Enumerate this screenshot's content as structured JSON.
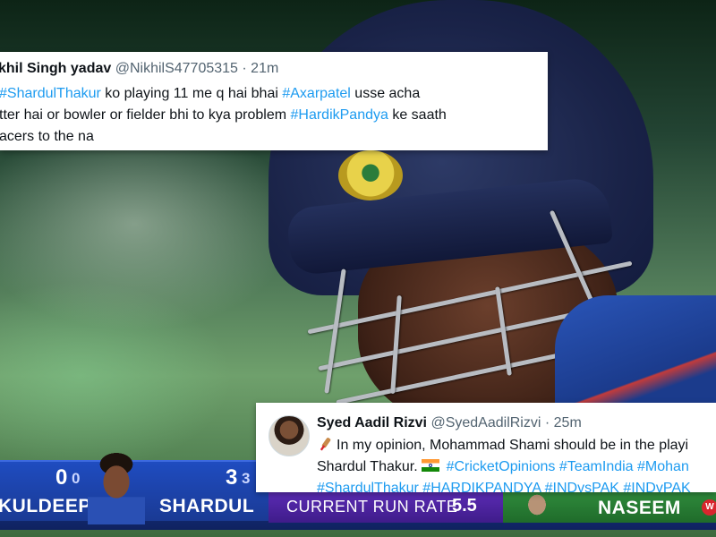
{
  "tweets": [
    {
      "author_name": "khil Singh yadav",
      "handle": "@NikhilS47705315",
      "separator": "·",
      "time": "21m",
      "line1": {
        "hashtag1": "#ShardulThakur",
        "text1": " ko playing 11 me q hai bhai ",
        "hashtag2": "#Axarpatel",
        "text2": " usse acha"
      },
      "line2": {
        "text1": "tter hai or bowler or fielder bhi to kya problem ",
        "hashtag1": "#HardikPandya",
        "text2": " ke saath"
      },
      "line3": {
        "text1": "acers to the na"
      }
    },
    {
      "author_name": "Syed Aadil Rizvi",
      "handle": "@SyedAadilRizvi",
      "separator": "·",
      "time": "25m",
      "avatar_icon": "profile-photo",
      "line1": {
        "text1": "In my opinion, Mohammad Shami should be in the playi"
      },
      "line2": {
        "text1": "Shardul Thakur. ",
        "hashtag1": "#CricketOpinions",
        "hashtag2": "#TeamIndia",
        "hashtag3": "#Mohan"
      },
      "line3": {
        "hashtag1": "#ShardulThakur",
        "hashtag2": "#HARDIKPANDYA",
        "hashtag3": "#INDvsPAK",
        "hashtag4": "#INDvPAK"
      }
    }
  ],
  "scoreboard": {
    "batter1": {
      "name": "KULDEEP",
      "runs": "0",
      "balls": "0"
    },
    "batter2": {
      "name": "SHARDUL",
      "runs": "3",
      "balls": "3"
    },
    "current_run_rate_label": "CURRENT RUN RATE",
    "current_run_rate_value": "5.5",
    "bowler": {
      "name": "NASEEM",
      "badge": "W"
    }
  },
  "colors": {
    "hashtag": "#1d9bf0",
    "scoreboard_blue": "#1a3a94",
    "run_rate_purple": "#4a22a0",
    "bowler_green": "#27803a",
    "wicket_red": "#d8262e"
  }
}
